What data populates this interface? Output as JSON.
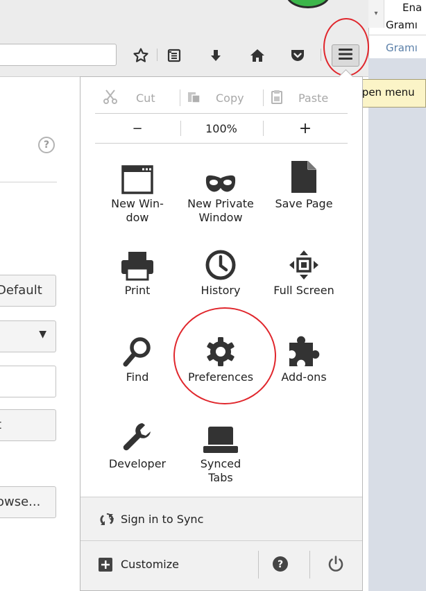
{
  "right_document": {
    "lines": [
      "Ena",
      "Gramı",
      "Gramı"
    ]
  },
  "toolbar": {
    "icons": [
      "star-icon",
      "reading-list-icon",
      "download-arrow-icon",
      "home-icon",
      "pocket-icon"
    ],
    "menu_button_icon": "hamburger-menu-icon",
    "tooltip": "Open menu"
  },
  "page_left": {
    "fields": [
      "Default",
      "",
      "",
      "t",
      "owse..."
    ]
  },
  "menu": {
    "edit": {
      "cut": "Cut",
      "copy": "Copy",
      "paste": "Paste"
    },
    "zoom": {
      "minus": "−",
      "level": "100%",
      "plus": "+"
    },
    "items": [
      {
        "label": "New Win-\ndow",
        "icon": "new-window-icon"
      },
      {
        "label": "New Private\nWindow",
        "icon": "private-mask-icon"
      },
      {
        "label": "Save Page",
        "icon": "save-page-icon"
      },
      {
        "label": "Print",
        "icon": "printer-icon"
      },
      {
        "label": "History",
        "icon": "history-clock-icon"
      },
      {
        "label": "Full Screen",
        "icon": "full-screen-icon"
      },
      {
        "label": "Find",
        "icon": "magnifier-icon"
      },
      {
        "label": "Preferences",
        "icon": "gear-icon"
      },
      {
        "label": "Add-ons",
        "icon": "puzzle-piece-icon"
      },
      {
        "label": "Developer",
        "icon": "wrench-icon"
      },
      {
        "label": "Synced\nTabs",
        "icon": "synced-tabs-icon"
      }
    ],
    "sync_label": "Sign in to Sync",
    "customize_label": "Customize",
    "help_icon": "help-question-icon",
    "quit_icon": "power-icon"
  },
  "colors": {
    "highlight_ring": "#e0262c",
    "tooltip_bg": "#fbf4c7",
    "icon_dark": "#333333",
    "disabled_text": "#a8a8a8"
  }
}
